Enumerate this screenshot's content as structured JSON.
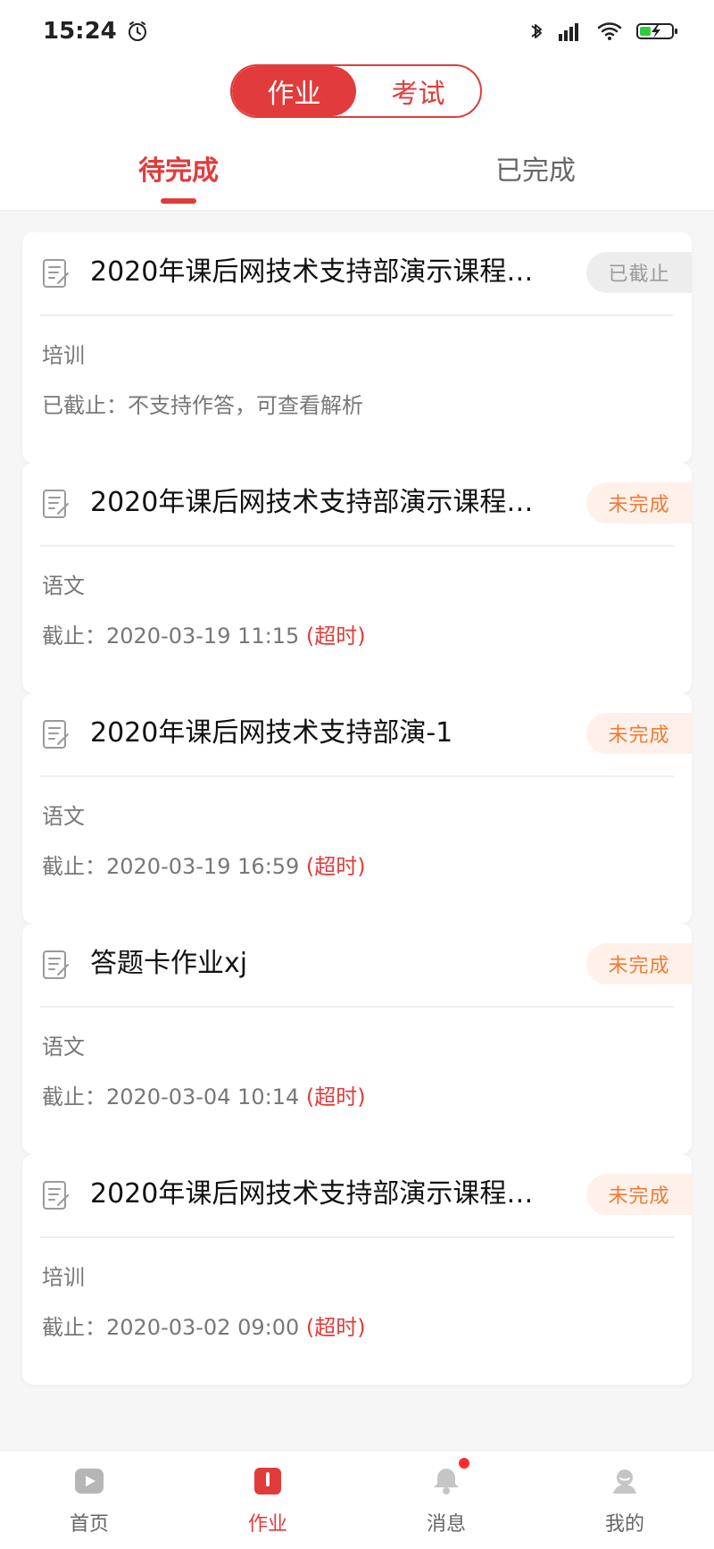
{
  "status_bar": {
    "time": "15:24",
    "battery_label": "battery"
  },
  "header": {
    "segmented": {
      "homework_label": "作业",
      "exam_label": "考试"
    },
    "subtabs": {
      "pending_label": "待完成",
      "done_label": "已完成"
    }
  },
  "list": [
    {
      "title": "2020年课后网技术支持部演示课程…",
      "status": "已截止",
      "subject": "培训",
      "deadline": "已截止：不支持作答，可查看解析",
      "timeout": ""
    },
    {
      "title": "2020年课后网技术支持部演示课程…",
      "status": "未完成",
      "subject": "语文",
      "deadline": "截止：2020-03-19  11:15",
      "timeout": "(超时)"
    },
    {
      "title": "2020年课后网技术支持部演-1",
      "status": "未完成",
      "subject": "语文",
      "deadline": "截止：2020-03-19  16:59",
      "timeout": "(超时)"
    },
    {
      "title": "答题卡作业xj",
      "status": "未完成",
      "subject": "语文",
      "deadline": "截止：2020-03-04  10:14",
      "timeout": "(超时)"
    },
    {
      "title": "2020年课后网技术支持部演示课程…",
      "status": "未完成",
      "subject": "培训",
      "deadline": "截止：2020-03-02  09:00",
      "timeout": "(超时)"
    }
  ],
  "bottom_nav": {
    "home_label": "首页",
    "homework_label": "作业",
    "message_label": "消息",
    "mine_label": "我的"
  },
  "colors": {
    "accent": "#e23b3b",
    "badge_incomplete_text": "#f07a36",
    "badge_incomplete_bg": "#fff1ea",
    "badge_closed_text": "#999999",
    "badge_closed_bg": "#ededed"
  }
}
